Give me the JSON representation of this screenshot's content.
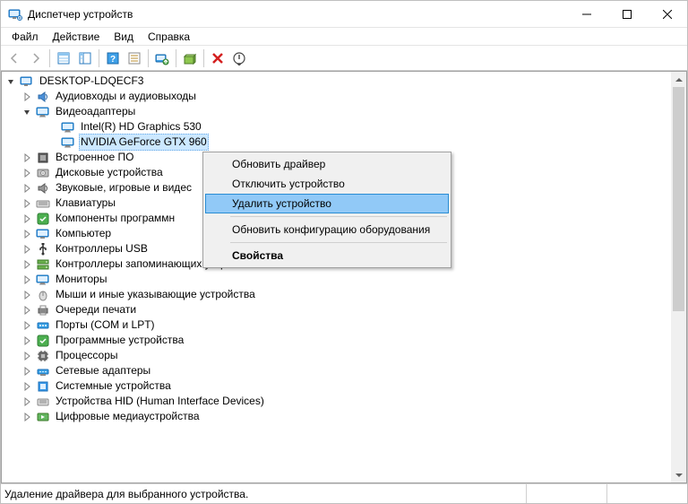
{
  "title": "Диспетчер устройств",
  "menubar": [
    "Файл",
    "Действие",
    "Вид",
    "Справка"
  ],
  "root": "DESKTOP-LDQECF3",
  "statusbar": "Удаление драйвера для выбранного устройства.",
  "categories": [
    {
      "label": "Аудиовходы и аудиовыходы",
      "icon": "audio",
      "expanded": false
    },
    {
      "label": "Видеоадаптеры",
      "icon": "display",
      "expanded": true,
      "children": [
        {
          "label": "Intel(R) HD Graphics 530",
          "icon": "display",
          "selected": false
        },
        {
          "label": "NVIDIA GeForce GTX 960",
          "icon": "display",
          "selected": true
        }
      ]
    },
    {
      "label": "Встроенное ПО",
      "icon": "firmware",
      "expanded": false
    },
    {
      "label": "Дисковые устройства",
      "icon": "disk",
      "expanded": false
    },
    {
      "label": "Звуковые, игровые и видес",
      "icon": "sound",
      "truncated": true,
      "expanded": false
    },
    {
      "label": "Клавиатуры",
      "icon": "keyboard",
      "expanded": false
    },
    {
      "label": "Компоненты программн",
      "icon": "software",
      "truncated": true,
      "expanded": false
    },
    {
      "label": "Компьютер",
      "icon": "computer",
      "expanded": false
    },
    {
      "label": "Контроллеры USB",
      "icon": "usb",
      "expanded": false
    },
    {
      "label": "Контроллеры запоминающих устройств",
      "icon": "storage",
      "expanded": false
    },
    {
      "label": "Мониторы",
      "icon": "monitor",
      "expanded": false
    },
    {
      "label": "Мыши и иные указывающие устройства",
      "icon": "mouse",
      "expanded": false
    },
    {
      "label": "Очереди печати",
      "icon": "printer",
      "expanded": false
    },
    {
      "label": "Порты (COM и LPT)",
      "icon": "port",
      "expanded": false
    },
    {
      "label": "Программные устройства",
      "icon": "software2",
      "expanded": false
    },
    {
      "label": "Процессоры",
      "icon": "cpu",
      "expanded": false
    },
    {
      "label": "Сетевые адаптеры",
      "icon": "network",
      "expanded": false
    },
    {
      "label": "Системные устройства",
      "icon": "system",
      "expanded": false
    },
    {
      "label": "Устройства HID (Human Interface Devices)",
      "icon": "hid",
      "expanded": false
    },
    {
      "label": "Цифровые медиаустройства",
      "icon": "media",
      "expanded": false
    }
  ],
  "context_menu": [
    {
      "label": "Обновить драйвер",
      "type": "item"
    },
    {
      "label": "Отключить устройство",
      "type": "item"
    },
    {
      "label": "Удалить устройство",
      "type": "item",
      "hover": true
    },
    {
      "type": "sep"
    },
    {
      "label": "Обновить конфигурацию оборудования",
      "type": "item"
    },
    {
      "type": "sep"
    },
    {
      "label": "Свойства",
      "type": "item",
      "bold": true
    }
  ]
}
